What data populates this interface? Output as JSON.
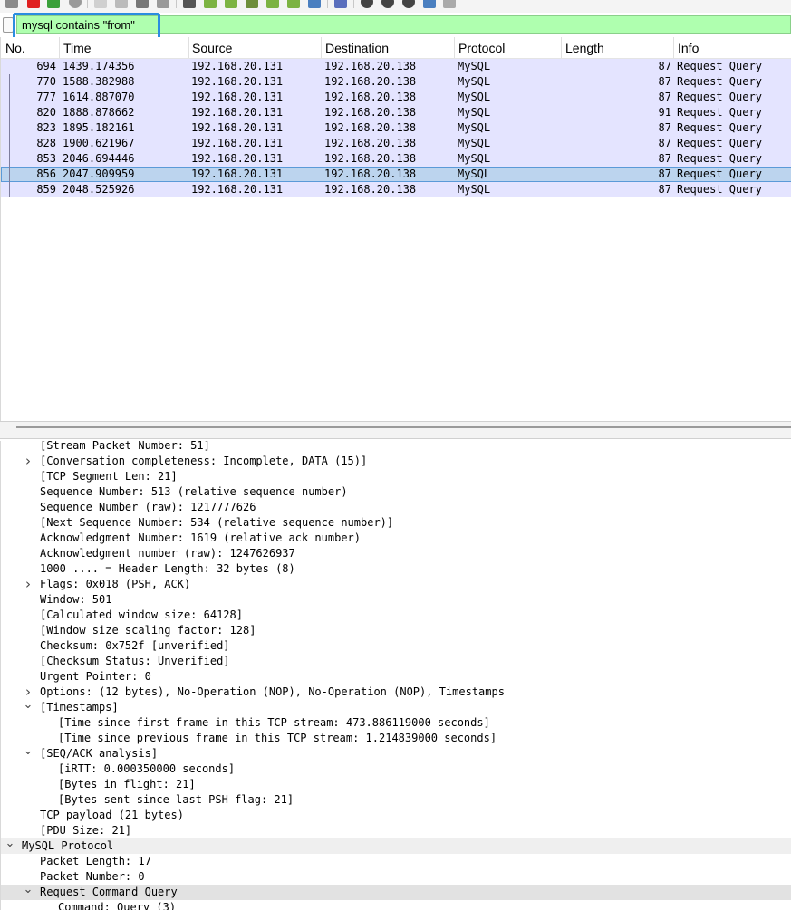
{
  "filter": {
    "value": "mysql contains \"from\""
  },
  "columns": [
    "No.",
    "Time",
    "Source",
    "Destination",
    "Protocol",
    "Length",
    "Info"
  ],
  "packets": [
    {
      "no": "694",
      "time": "1439.174356",
      "src": "192.168.20.131",
      "dst": "192.168.20.138",
      "proto": "MySQL",
      "len": "87",
      "info": "Request Query"
    },
    {
      "no": "770",
      "time": "1588.382988",
      "src": "192.168.20.131",
      "dst": "192.168.20.138",
      "proto": "MySQL",
      "len": "87",
      "info": "Request Query"
    },
    {
      "no": "777",
      "time": "1614.887070",
      "src": "192.168.20.131",
      "dst": "192.168.20.138",
      "proto": "MySQL",
      "len": "87",
      "info": "Request Query"
    },
    {
      "no": "820",
      "time": "1888.878662",
      "src": "192.168.20.131",
      "dst": "192.168.20.138",
      "proto": "MySQL",
      "len": "91",
      "info": "Request Query"
    },
    {
      "no": "823",
      "time": "1895.182161",
      "src": "192.168.20.131",
      "dst": "192.168.20.138",
      "proto": "MySQL",
      "len": "87",
      "info": "Request Query"
    },
    {
      "no": "828",
      "time": "1900.621967",
      "src": "192.168.20.131",
      "dst": "192.168.20.138",
      "proto": "MySQL",
      "len": "87",
      "info": "Request Query"
    },
    {
      "no": "853",
      "time": "2046.694446",
      "src": "192.168.20.131",
      "dst": "192.168.20.138",
      "proto": "MySQL",
      "len": "87",
      "info": "Request Query"
    },
    {
      "no": "856",
      "time": "2047.909959",
      "src": "192.168.20.131",
      "dst": "192.168.20.138",
      "proto": "MySQL",
      "len": "87",
      "info": "Request Query"
    },
    {
      "no": "859",
      "time": "2048.525926",
      "src": "192.168.20.131",
      "dst": "192.168.20.138",
      "proto": "MySQL",
      "len": "87",
      "info": "Request Query"
    }
  ],
  "details": [
    {
      "text": "[Stream Packet Number: 51]"
    },
    {
      "text": "[Conversation completeness: Incomplete, DATA (15)]",
      "arrow": "collapsed"
    },
    {
      "text": "[TCP Segment Len: 21]"
    },
    {
      "text": "Sequence Number: 513    (relative sequence number)"
    },
    {
      "text": "Sequence Number (raw): 1217777626"
    },
    {
      "text": "[Next Sequence Number: 534    (relative sequence number)]"
    },
    {
      "text": "Acknowledgment Number: 1619    (relative ack number)"
    },
    {
      "text": "Acknowledgment number (raw): 1247626937"
    },
    {
      "text": "1000 .... = Header Length: 32 bytes (8)"
    },
    {
      "text": "Flags: 0x018 (PSH, ACK)",
      "arrow": "collapsed"
    },
    {
      "text": "Window: 501"
    },
    {
      "text": "[Calculated window size: 64128]"
    },
    {
      "text": "[Window size scaling factor: 128]"
    },
    {
      "text": "Checksum: 0x752f [unverified]"
    },
    {
      "text": "[Checksum Status: Unverified]"
    },
    {
      "text": "Urgent Pointer: 0"
    },
    {
      "text": "Options: (12 bytes), No-Operation (NOP), No-Operation (NOP), Timestamps",
      "arrow": "collapsed"
    },
    {
      "text": "[Timestamps]",
      "arrow": "expanded"
    },
    {
      "text": "[Time since first frame in this TCP stream: 473.886119000 seconds]"
    },
    {
      "text": "[Time since previous frame in this TCP stream: 1.214839000 seconds]"
    },
    {
      "text": "[SEQ/ACK analysis]",
      "arrow": "expanded"
    },
    {
      "text": "[iRTT: 0.000350000 seconds]"
    },
    {
      "text": "[Bytes in flight: 21]"
    },
    {
      "text": "[Bytes sent since last PSH flag: 21]"
    },
    {
      "text": "TCP payload (21 bytes)"
    },
    {
      "text": "[PDU Size: 21]"
    },
    {
      "text": "MySQL Protocol",
      "arrow": "expanded"
    },
    {
      "text": "Packet Length: 17"
    },
    {
      "text": "Packet Number: 0"
    },
    {
      "text": "Request Command Query",
      "arrow": "expanded"
    },
    {
      "text": "Command: Query (3)"
    }
  ]
}
